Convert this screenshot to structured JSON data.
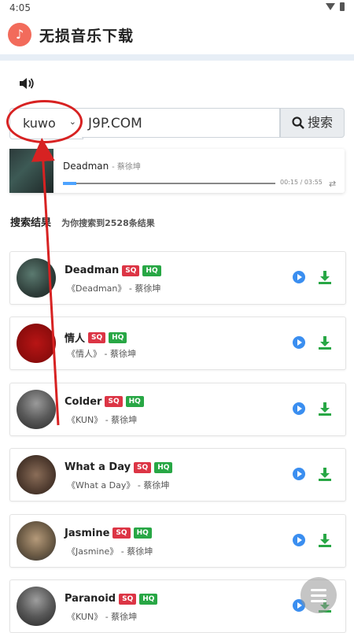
{
  "status": {
    "time": "4:05"
  },
  "app": {
    "title": "无损音乐下载",
    "logo_icon": "music-note-icon"
  },
  "search": {
    "source": "kuwo",
    "query": "J9P.COM",
    "button_label": "搜索"
  },
  "player": {
    "title": "Deadman",
    "artist": "蔡徐坤",
    "time": "00:15 / 03:55",
    "progress": 0.064
  },
  "results": {
    "title": "搜索结果",
    "count": "为你搜索到2528条结果"
  },
  "songs": [
    {
      "name": "Deadman",
      "meta": "《Deadman》 - 蔡徐坤",
      "sq": "SQ",
      "hq": "HQ"
    },
    {
      "name": "情人",
      "meta": "《情人》 - 蔡徐坤",
      "sq": "SQ",
      "hq": "HQ"
    },
    {
      "name": "Colder",
      "meta": "《KUN》 - 蔡徐坤",
      "sq": "SQ",
      "hq": "HQ"
    },
    {
      "name": "What a Day",
      "meta": "《What a Day》 - 蔡徐坤",
      "sq": "SQ",
      "hq": "HQ"
    },
    {
      "name": "Jasmine",
      "meta": "《Jasmine》 - 蔡徐坤",
      "sq": "SQ",
      "hq": "HQ"
    },
    {
      "name": "Paranoid",
      "meta": "《KUN》 - 蔡徐坤",
      "sq": "SQ",
      "hq": "HQ"
    }
  ],
  "colors": {
    "accent": "#f26b5b",
    "play": "#3a8ef0",
    "download": "#28a745",
    "sq": "#dc3545",
    "hq": "#28a745",
    "annotation": "#d72222"
  }
}
